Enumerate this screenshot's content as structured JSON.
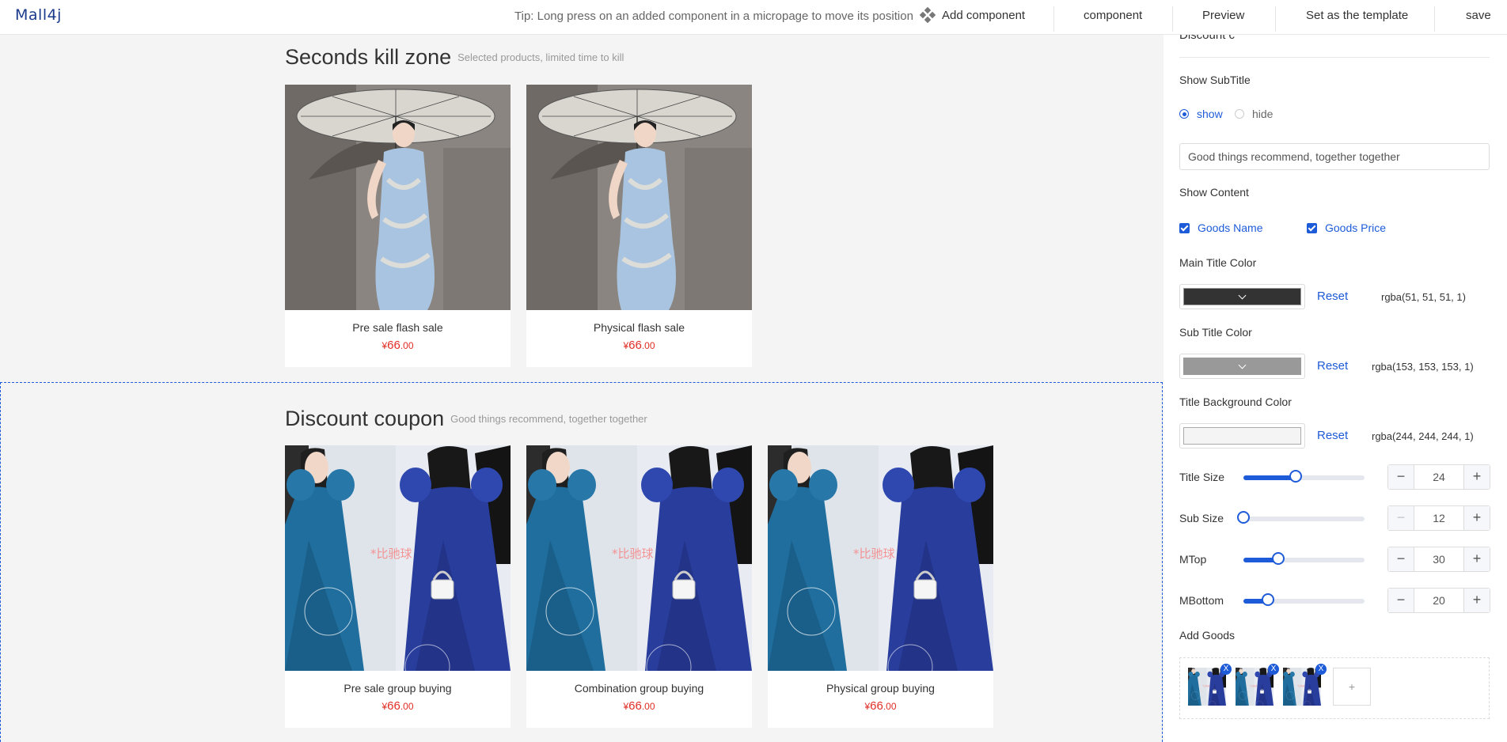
{
  "header": {
    "logo": "Mall4j",
    "tip": "Tip: Long press on an added component in a micropage to move its position",
    "add_component": "Add component",
    "component": "component",
    "preview": "Preview",
    "set_template": "Set as the template",
    "save": "save"
  },
  "canvas": {
    "seckill": {
      "title": "Seconds kill zone",
      "subtitle": "Selected products, limited time to kill",
      "products": [
        {
          "name": "Pre sale flash sale",
          "currency": "¥",
          "price_int": "66",
          "price_dec": ".00"
        },
        {
          "name": "Physical flash sale",
          "currency": "¥",
          "price_int": "66",
          "price_dec": ".00"
        }
      ]
    },
    "coupon": {
      "title": "Discount coupon",
      "subtitle": "Good things recommend, together together",
      "products": [
        {
          "name": "Pre sale group buying",
          "currency": "¥",
          "price_int": "66",
          "price_dec": ".00"
        },
        {
          "name": "Combination group buying",
          "currency": "¥",
          "price_int": "66",
          "price_dec": ".00"
        },
        {
          "name": "Physical group buying",
          "currency": "¥",
          "price_int": "66",
          "price_dec": ".00"
        }
      ]
    }
  },
  "panel": {
    "header_cut": "Discount c",
    "show_subtitle_label": "Show SubTitle",
    "show_option": "show",
    "hide_option": "hide",
    "subtitle_value": "Good things recommend, together together",
    "show_content_label": "Show Content",
    "goods_name": "Goods Name",
    "goods_price": "Goods Price",
    "main_title_color_label": "Main Title Color",
    "main_title_color": "rgba(51, 51, 51, 1)",
    "sub_title_color_label": "Sub Title Color",
    "sub_title_color": "rgba(153, 153, 153, 1)",
    "title_bg_color_label": "Title Background Color",
    "title_bg_color": "rgba(244, 244, 244, 1)",
    "reset": "Reset",
    "title_size_label": "Title Size",
    "title_size": "24",
    "sub_size_label": "Sub Size",
    "sub_size": "12",
    "mtop_label": "MTop",
    "mtop": "30",
    "mbottom_label": "MBottom",
    "mbottom": "20",
    "add_goods_label": "Add Goods",
    "remove_mark": "X",
    "add_mark": "+"
  },
  "sliders": {
    "title_size": 0.43,
    "sub_size": 0.0,
    "mtop": 0.29,
    "mbottom": 0.2
  },
  "colors": {
    "accent": "#1e5bd8",
    "price": "#e02e24",
    "main_title": "#333333",
    "sub_title": "#999999",
    "title_bg": "#f4f4f4"
  }
}
